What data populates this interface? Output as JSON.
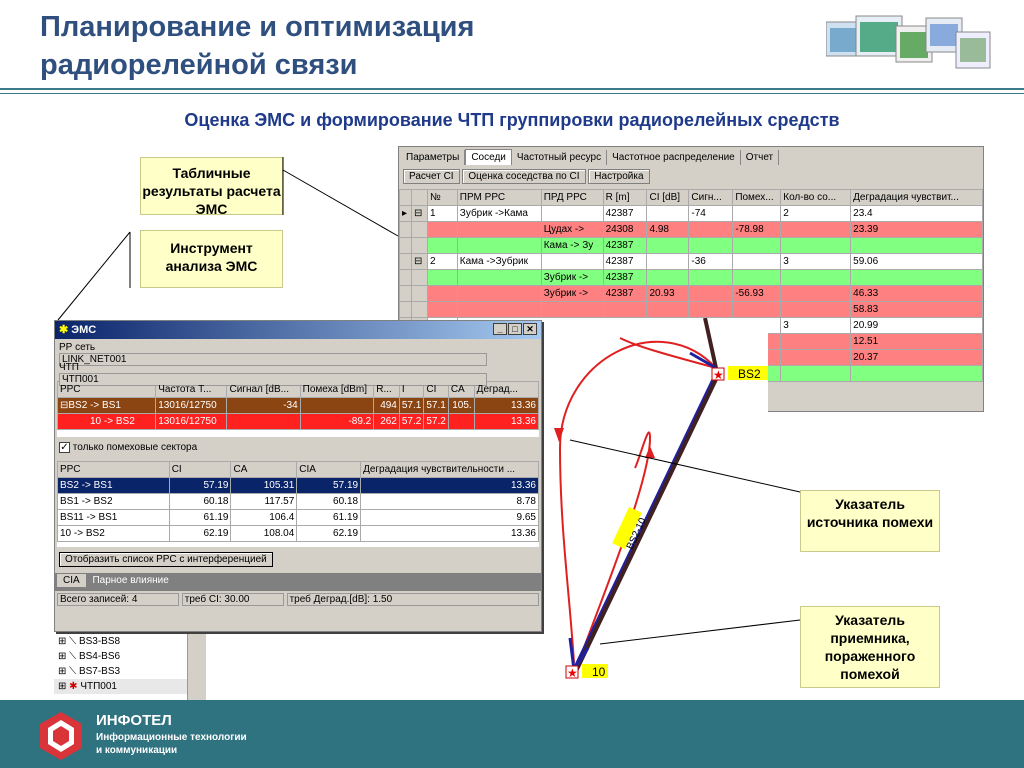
{
  "slide": {
    "title_line1": "Планирование и оптимизация",
    "title_line2": "радиорелейной связи",
    "subtitle": "Оценка ЭМС и формирование ЧТП группировки радиорелейных средств"
  },
  "callouts": {
    "table_results": "Табличные результаты расчета ЭМС",
    "tool": "Инструмент анализа ЭМС",
    "source_pointer": "Указатель источника помехи",
    "receiver_pointer": "Указатель приемника, пораженного помехой"
  },
  "main_window": {
    "tabs": [
      "Параметры",
      "Соседи",
      "Частотный ресурс",
      "Частотное распределение",
      "Отчет"
    ],
    "active_tab": "Соседи",
    "toolbar": [
      "Расчет CI",
      "Оценка соседства по CI",
      "Настройка"
    ],
    "columns": [
      "№",
      "ПРМ РРС",
      "ПРД РРС",
      "R [m]",
      "CI [dB]",
      "Сигн...",
      "Помех...",
      "Кол-во со...",
      "Деградация чувствит..."
    ],
    "rows": [
      {
        "style": "white",
        "marker": "▸",
        "expand": "⊟",
        "num": "1",
        "prm": "Зубрик ->Кама",
        "prd": "",
        "r": "42387",
        "ci": "",
        "sig": "-74",
        "pom": "",
        "cnt": "2",
        "deg": "23.4"
      },
      {
        "style": "red",
        "marker": "",
        "expand": "",
        "num": "",
        "prm": "",
        "prd": "Цудах    ->",
        "r": "24308",
        "ci": "4.98",
        "sig": "",
        "pom": "-78.98",
        "cnt": "",
        "deg": "23.39"
      },
      {
        "style": "green",
        "marker": "",
        "expand": "",
        "num": "",
        "prm": "",
        "prd": "Кама -> Зу",
        "r": "42387",
        "ci": "",
        "sig": "",
        "pom": "",
        "cnt": "",
        "deg": ""
      },
      {
        "style": "white",
        "marker": "",
        "expand": "⊟",
        "num": "2",
        "prm": "Кама ->Зубрик",
        "prd": "",
        "r": "42387",
        "ci": "",
        "sig": "-36",
        "pom": "",
        "cnt": "3",
        "deg": "59.06"
      },
      {
        "style": "green",
        "marker": "",
        "expand": "",
        "num": "",
        "prm": "",
        "prd": "Зубрик ->",
        "r": "42387",
        "ci": "",
        "sig": "",
        "pom": "",
        "cnt": "",
        "deg": ""
      },
      {
        "style": "red",
        "marker": "",
        "expand": "",
        "num": "",
        "prm": "",
        "prd": "Зубрик ->",
        "r": "42387",
        "ci": "20.93",
        "sig": "",
        "pom": "-56.93",
        "cnt": "",
        "deg": "46.33"
      },
      {
        "style": "red",
        "marker": "",
        "expand": "",
        "num": "",
        "prm": "",
        "prd": "",
        "r": "",
        "ci": "",
        "sig": "",
        "pom": "",
        "cnt": "",
        "deg": "58.83"
      },
      {
        "style": "white",
        "marker": "",
        "expand": "",
        "num": "",
        "prm": "",
        "prd": "",
        "r": "",
        "ci": "",
        "sig": "",
        "pom": "",
        "cnt": "3",
        "deg": "20.99"
      },
      {
        "style": "red",
        "marker": "",
        "expand": "",
        "num": "",
        "prm": "",
        "prd": "",
        "r": "",
        "ci": "",
        "sig": "",
        "pom": "",
        "cnt": "",
        "deg": "12.51"
      },
      {
        "style": "red",
        "marker": "",
        "expand": "",
        "num": "",
        "prm": "",
        "prd": "",
        "r": "",
        "ci": "",
        "sig": "",
        "pom": "",
        "cnt": "",
        "deg": "20.37"
      },
      {
        "style": "green",
        "marker": "",
        "expand": "",
        "num": "",
        "prm": "",
        "prd": "",
        "r": "",
        "ci": "",
        "sig": "",
        "pom": "",
        "cnt": "",
        "deg": ""
      }
    ]
  },
  "ems_window": {
    "title": "ЭМС",
    "rr_label": "РР сеть",
    "rr_value": "LINK_NET001",
    "chtp_label": "ЧТП",
    "chtp_value": "ЧТП001",
    "top_columns": [
      "РРС",
      "Частота Т...",
      "Сигнал [dB...",
      "Помеха [dBm]",
      "R...",
      "I",
      "CI",
      "CA",
      "Деград..."
    ],
    "top_rows": [
      {
        "style": "brown",
        "expand": "⊟",
        "rrs": "BS2 -> BS1",
        "freq": "13016/12750",
        "sig": "-34",
        "pom": "",
        "r": "494",
        "i": "57.1",
        "ci": "57.1",
        "ca": "105.",
        "deg": "13.36"
      },
      {
        "style": "red",
        "expand": "",
        "rrs": "10 -> BS2",
        "freq": "13016/12750",
        "sig": "",
        "pom": "-89.2",
        "r": "262",
        "i": "57.2",
        "ci": "57.2",
        "ca": "",
        "deg": "13.36"
      }
    ],
    "checkbox_label": "только помеховые сектора",
    "bottom_columns": [
      "РРС",
      "CI",
      "CA",
      "CIA",
      "Деградация чувствительности ..."
    ],
    "bottom_rows": [
      {
        "selected": true,
        "rrs": "BS2 -> BS1",
        "ci": "57.19",
        "ca": "105.31",
        "cia": "57.19",
        "deg": "13.36"
      },
      {
        "selected": false,
        "rrs": "BS1 -> BS2",
        "ci": "60.18",
        "ca": "117.57",
        "cia": "60.18",
        "deg": "8.78"
      },
      {
        "selected": false,
        "rrs": "BS11 -> BS1",
        "ci": "61.19",
        "ca": "106.4",
        "cia": "61.19",
        "deg": "9.65"
      },
      {
        "selected": false,
        "rrs": "10 -> BS2",
        "ci": "62.19",
        "ca": "108.04",
        "cia": "62.19",
        "deg": "13.36"
      }
    ],
    "show_button": "Отобразить список РРС с интерференцией",
    "tab_cia": "CIA",
    "tab_pair": "Парное влияние",
    "status_records": "Всего записей: 4",
    "status_ci": "треб CI: 30.00",
    "status_deg": "треб Деград.[dB]: 1.50"
  },
  "tree": [
    "BS3-BS8",
    "BS4-BS6",
    "BS7-BS3",
    "ЧТП001"
  ],
  "map": {
    "label_bs2": "BS2",
    "label_10": "10",
    "link_label": "BS2-10"
  },
  "footer": {
    "brand": "ИНФОТЕЛ",
    "tagline1": "Информационные технологии",
    "tagline2": "и коммуникации"
  },
  "colors": {
    "green_row": "#80ff80",
    "red_row": "#ff8080",
    "callout_bg": "#ffffc8",
    "footer_bg": "#2f7280",
    "title_color": "#2f4f7f"
  }
}
